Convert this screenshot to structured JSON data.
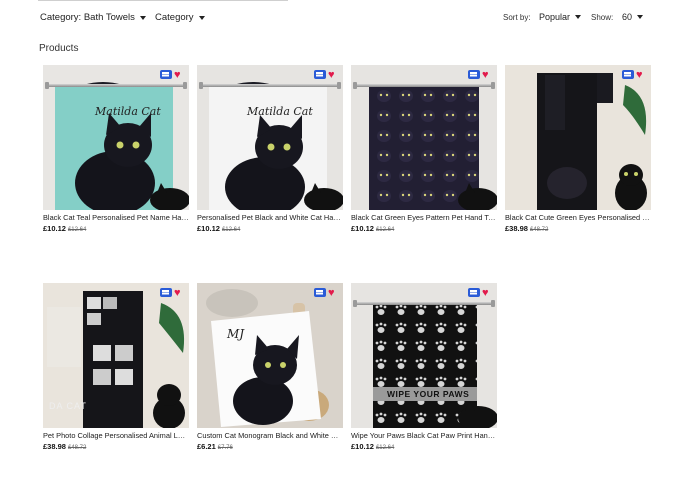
{
  "filters": {
    "category_filter": "Category: Bath Towels",
    "category_dropdown": "Category"
  },
  "sort": {
    "label": "Sort by:",
    "value": "Popular"
  },
  "show": {
    "label": "Show:",
    "value": "60"
  },
  "section_title": "Products",
  "products": [
    {
      "title": "Black Cat Teal Personalised Pet Name Hand Towel",
      "price": "£10.12",
      "original_price": "£12.64",
      "towel_text": "Matilda Cat"
    },
    {
      "title": "Personalised Pet Black and White Cat Hand Towel",
      "price": "£10.12",
      "original_price": "£12.64",
      "towel_text": "Matilda Cat"
    },
    {
      "title": "Black Cat Green Eyes Pattern Pet Hand Towel",
      "price": "£10.12",
      "original_price": "£12.64",
      "towel_text": ""
    },
    {
      "title": "Black Cat Cute Green Eyes Personalised Bath Towel",
      "price": "£38.98",
      "original_price": "£48.72",
      "towel_text": ""
    },
    {
      "title": "Pet Photo Collage Personalised Animal Lover Bath Towel",
      "price": "£38.98",
      "original_price": "£48.72",
      "towel_text": "DA CAT"
    },
    {
      "title": "Custom Cat Monogram Black and White Hand Towel",
      "price": "£6.21",
      "original_price": "£7.76",
      "towel_text": "MJ"
    },
    {
      "title": "Wipe Your Paws Black Cat Paw Print Hand Towel",
      "price": "£10.12",
      "original_price": "£12.64",
      "towel_text": "WIPE YOUR PAWS"
    }
  ]
}
